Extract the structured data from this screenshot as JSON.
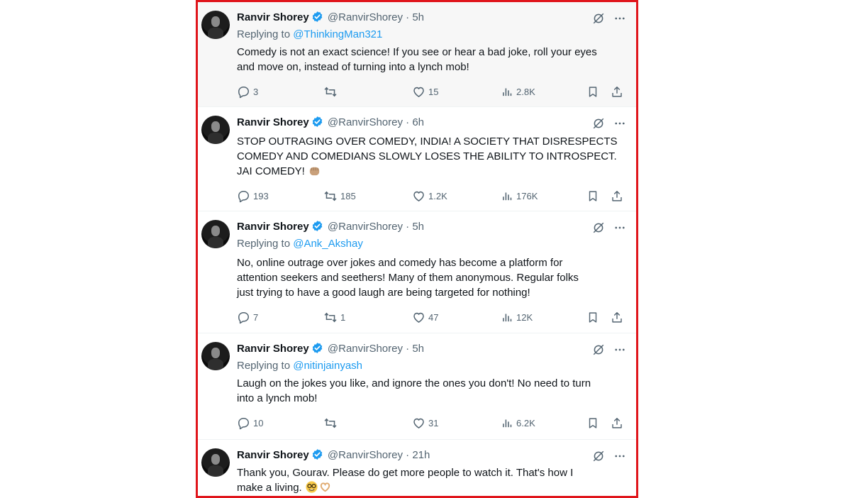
{
  "tweets": [
    {
      "name": "Ranvir Shorey",
      "handle": "@RanvirShorey",
      "sep": "·",
      "time": "5h",
      "replying_label": "Replying to",
      "replying_to": "@ThinkingMan321",
      "text_lines": [
        "Comedy is not an exact science! If you see or hear a bad joke, roll your eyes",
        "and move on, instead of turning into a lynch mob!"
      ],
      "replies": "3",
      "retweets": "",
      "likes": "15",
      "views": "2.8K"
    },
    {
      "name": "Ranvir Shorey",
      "handle": "@RanvirShorey",
      "sep": "·",
      "time": "6h",
      "text_lines": [
        "STOP OUTRAGING OVER COMEDY, INDIA! A SOCIETY THAT DISRESPECTS",
        "COMEDY AND COMEDIANS SLOWLY LOSES THE ABILITY TO INTROSPECT.",
        "JAI COMEDY!"
      ],
      "emoji": "raised-fist-emoji",
      "replies": "193",
      "retweets": "185",
      "likes": "1.2K",
      "views": "176K"
    },
    {
      "name": "Ranvir Shorey",
      "handle": "@RanvirShorey",
      "sep": "·",
      "time": "5h",
      "replying_label": "Replying to",
      "replying_to": "@Ank_Akshay",
      "text_lines": [
        "No, online outrage over jokes and comedy has become a platform for",
        "attention seekers and seethers! Many of them anonymous. Regular folks",
        "just trying to have a good laugh are being targeted for nothing!"
      ],
      "replies": "7",
      "retweets": "1",
      "likes": "47",
      "views": "12K"
    },
    {
      "name": "Ranvir Shorey",
      "handle": "@RanvirShorey",
      "sep": "·",
      "time": "5h",
      "replying_label": "Replying to",
      "replying_to": "@nitinjainyash",
      "text_lines": [
        "Laugh on the jokes you like, and ignore the ones you don't! No need to turn",
        "into a lynch mob!"
      ],
      "replies": "10",
      "retweets": "",
      "likes": "31",
      "views": "6.2K"
    },
    {
      "name": "Ranvir Shorey",
      "handle": "@RanvirShorey",
      "sep": "·",
      "time": "21h",
      "text_lines": [
        "Thank you, Gourav. Please do get more people to watch it. That's how I",
        "make a living."
      ],
      "emoji": "nerd-face-and-heart-hands-emoji"
    }
  ],
  "colors": {
    "accent": "#1d9bf0",
    "muted": "#536471",
    "border": "#e0151b",
    "highlight_bg": "#f7f7f7"
  }
}
